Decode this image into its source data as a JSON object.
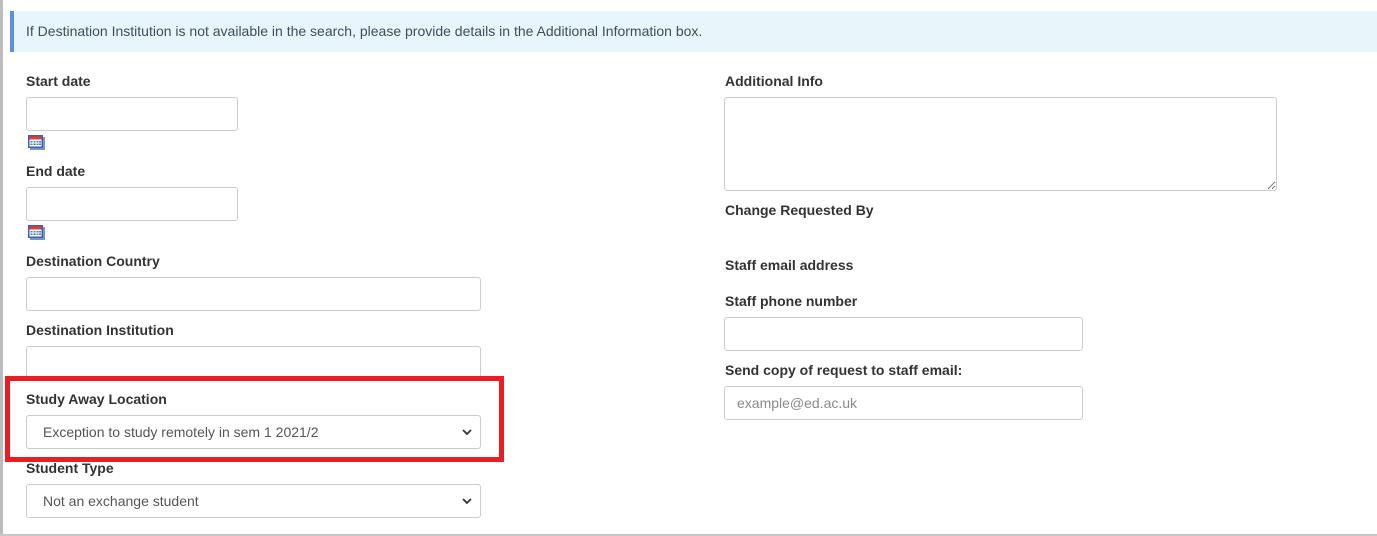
{
  "notice": {
    "text": "If Destination Institution is not available in the search, please provide details in the Additional Information box."
  },
  "left_form": {
    "start_date": {
      "label": "Start date",
      "value": "",
      "icon": "calendar-icon"
    },
    "end_date": {
      "label": "End date",
      "value": "",
      "icon": "calendar-icon"
    },
    "destination_country": {
      "label": "Destination Country",
      "value": ""
    },
    "destination_institution": {
      "label": "Destination Institution",
      "value": ""
    },
    "study_away_location": {
      "label": "Study Away Location",
      "selected": "Exception to study remotely in sem 1 2021/2",
      "icon": "chevron-down-icon"
    },
    "student_type": {
      "label": "Student Type",
      "selected": "Not an exchange student",
      "icon": "chevron-down-icon"
    }
  },
  "right_form": {
    "additional_info": {
      "label": "Additional Info",
      "value": ""
    },
    "change_requested_by": {
      "label": "Change Requested By"
    },
    "staff_email_address": {
      "label": "Staff email address"
    },
    "staff_phone_number": {
      "label": "Staff phone number",
      "value": ""
    },
    "send_copy": {
      "label": "Send copy of request to staff email:",
      "value": "",
      "placeholder": "example@ed.ac.uk"
    }
  },
  "annotation": {
    "highlight_color": "#ec1c24",
    "target": "Study Away Location"
  },
  "colors": {
    "notice_bg": "#e8f6fb",
    "notice_border": "#5b8fe0",
    "label_text": "#333333"
  },
  "chevron_glyph": "⌄"
}
